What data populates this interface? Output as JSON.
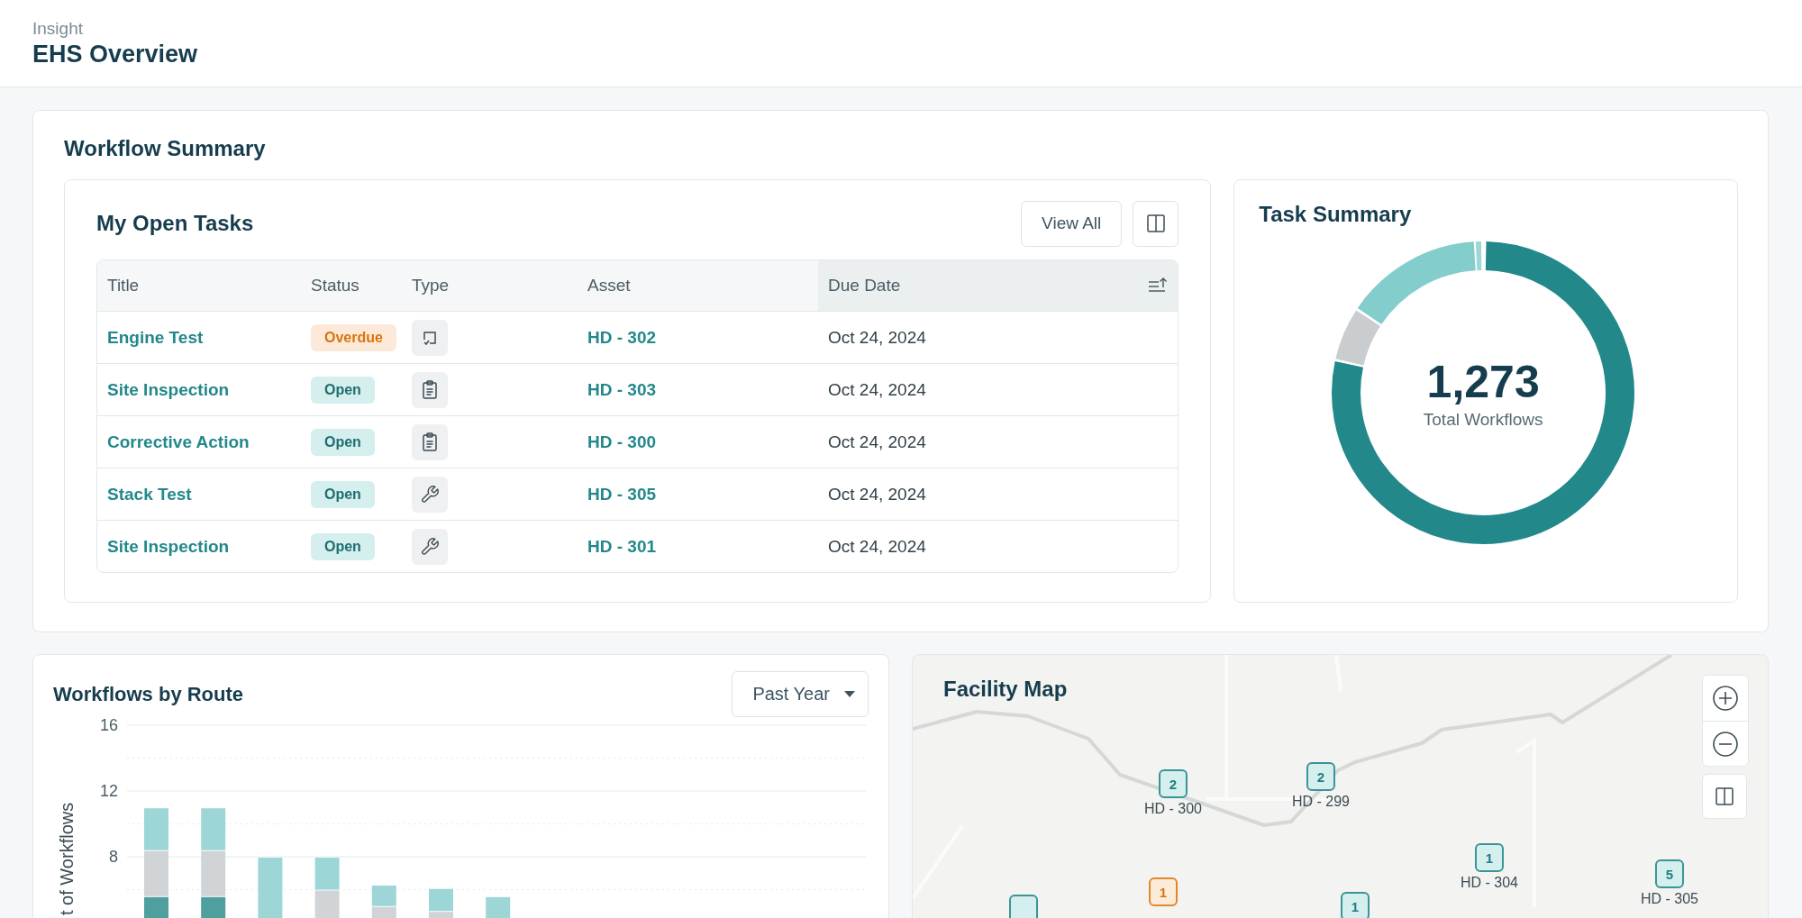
{
  "header": {
    "app": "Insight",
    "title": "EHS Overview"
  },
  "workflow_summary": {
    "title": "Workflow Summary",
    "open_tasks": {
      "title": "My Open Tasks",
      "view_all": "View All",
      "columns": [
        {
          "label": "Title",
          "sorted": false
        },
        {
          "label": "Status",
          "sorted": false
        },
        {
          "label": "Type",
          "sorted": false
        },
        {
          "label": "Asset",
          "sorted": false
        },
        {
          "label": "Due Date",
          "sorted": true
        }
      ],
      "rows": [
        {
          "title": "Engine Test",
          "status": {
            "text": "Overdue",
            "kind": "overdue"
          },
          "type": {
            "kind": "checkbox"
          },
          "asset": "HD - 302",
          "due": "Oct 24, 2024"
        },
        {
          "title": "Site Inspection",
          "status": {
            "text": "Open",
            "kind": "open"
          },
          "type": {
            "kind": "clipboard"
          },
          "asset": "HD - 303",
          "due": "Oct 24, 2024"
        },
        {
          "title": "Corrective Action",
          "status": {
            "text": "Open",
            "kind": "open"
          },
          "type": {
            "kind": "clipboard"
          },
          "asset": "HD - 300",
          "due": "Oct 24, 2024"
        },
        {
          "title": "Stack Test",
          "status": {
            "text": "Open",
            "kind": "open"
          },
          "type": {
            "kind": "wrench"
          },
          "asset": "HD - 305",
          "due": "Oct 24, 2024"
        },
        {
          "title": "Site Inspection",
          "status": {
            "text": "Open",
            "kind": "open"
          },
          "type": {
            "kind": "wrench"
          },
          "asset": "HD - 301",
          "due": "Oct 24, 2024"
        }
      ]
    },
    "task_summary": {
      "title": "Task Summary",
      "total": "1,273",
      "total_label": "Total Workflows"
    }
  },
  "workflows_by_route": {
    "title": "Workflows by Route",
    "range": "Past Year",
    "chart_data": {
      "type": "bar",
      "ylabel": "t of Workflows",
      "stacked": true,
      "ylim": [
        0,
        16
      ],
      "yticks": [
        8,
        12,
        16
      ],
      "series": [
        {
          "color": "#4f9f9f",
          "values": [
            5.6,
            5.6,
            0,
            0,
            0,
            0,
            0
          ]
        },
        {
          "color": "#d0d4d7",
          "values": [
            2.8,
            2.8,
            0,
            6,
            5,
            4.7,
            0
          ]
        },
        {
          "color": "#9dd6d6",
          "values": [
            2.6,
            2.6,
            8,
            2,
            1.3,
            1.4,
            5.6
          ]
        }
      ]
    }
  },
  "facility_map": {
    "title": "Facility Map",
    "markers": [
      {
        "count": "2",
        "label": "HD - 300",
        "kind": "normal"
      },
      {
        "count": "2",
        "label": "HD - 299",
        "kind": "normal"
      },
      {
        "kind": "normal"
      },
      {
        "count": "1",
        "kind": "alert"
      },
      {
        "count": "1",
        "kind": "normal"
      },
      {
        "count": "1",
        "label": "HD - 304",
        "kind": "normal"
      },
      {
        "count": "5",
        "label": "HD - 305",
        "kind": "normal"
      }
    ]
  }
}
